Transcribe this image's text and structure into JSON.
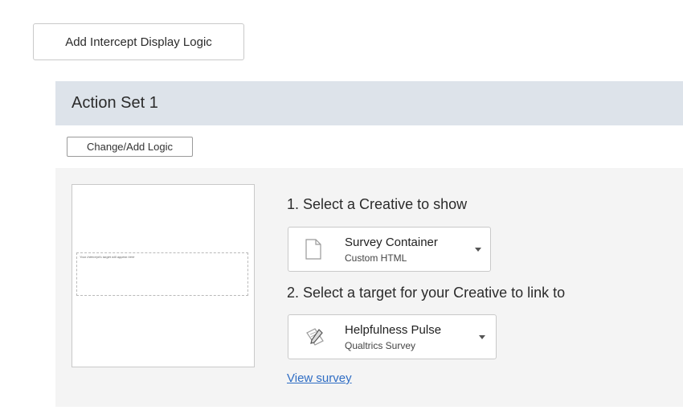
{
  "toolbar": {
    "add_logic_label": "Add Intercept Display Logic"
  },
  "action_set": {
    "title": "Action Set 1",
    "change_logic_label": "Change/Add Logic",
    "preview_placeholder": "Your Intercept's target will appear here",
    "step1_label": "1. Select a Creative to show",
    "creative": {
      "name": "Survey Container",
      "type": "Custom HTML",
      "icon": "document-icon"
    },
    "step2_label": "2. Select a target for your Creative to link to",
    "target": {
      "name": "Helpfulness Pulse",
      "type": "Qualtrics Survey",
      "icon": "pencil-paper-icon"
    },
    "view_link_label": "View survey"
  }
}
